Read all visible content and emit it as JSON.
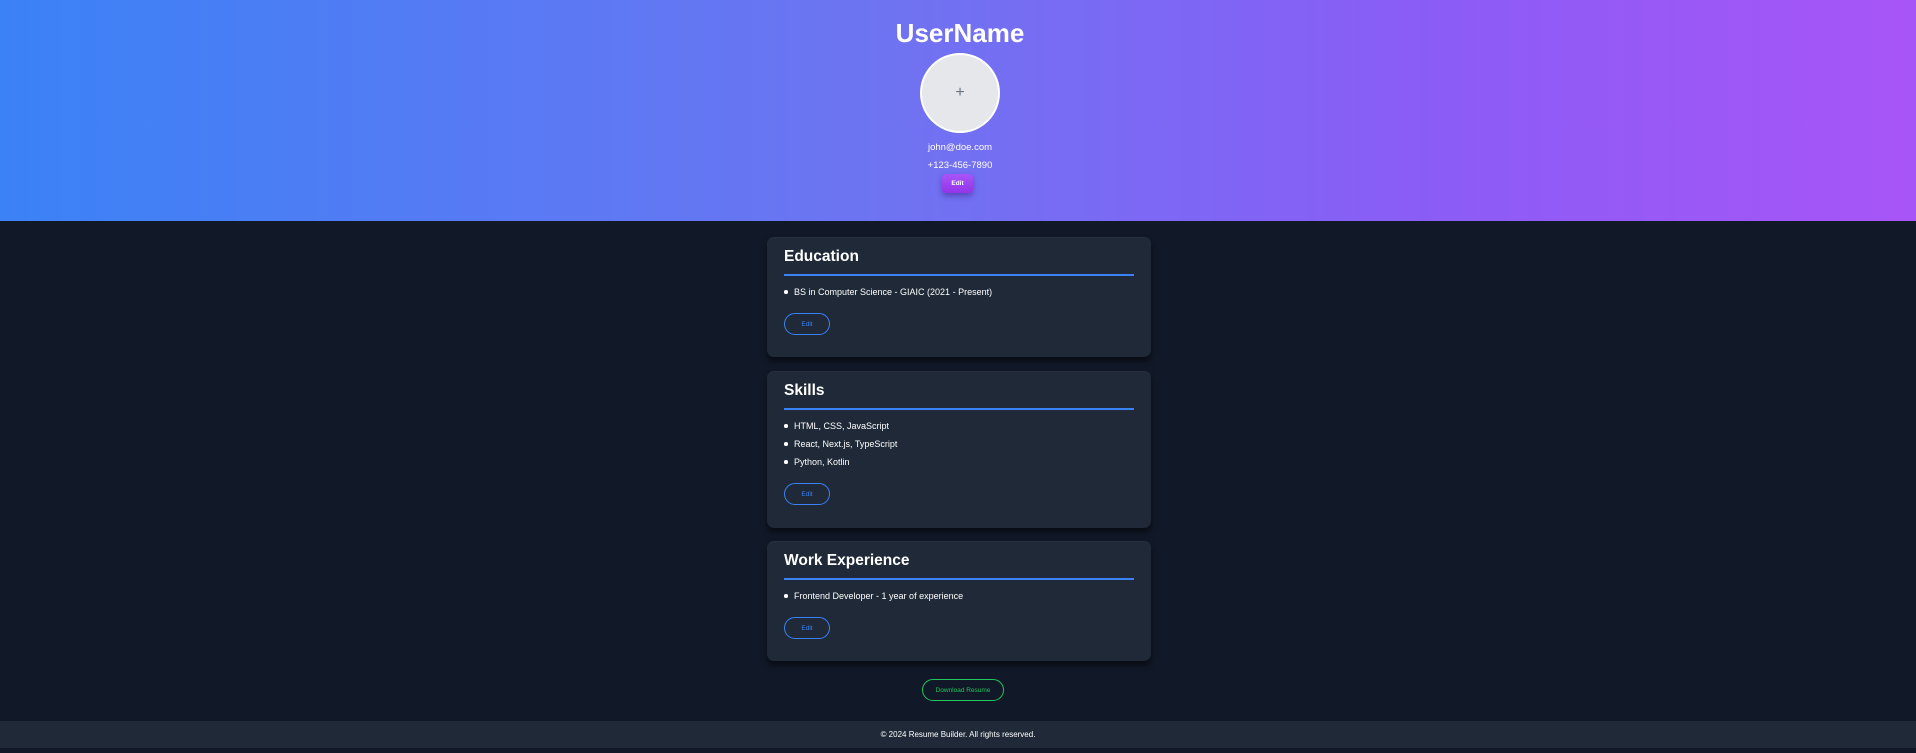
{
  "profile": {
    "name": "UserName",
    "avatar_icon": "+",
    "email": "john@doe.com",
    "phone": "+123-456-7890",
    "edit_label": "Edit"
  },
  "sections": {
    "education": {
      "title": "Education",
      "items": [
        "BS in Computer Science - GIAIC (2021 - Present)"
      ],
      "edit_label": "Edit"
    },
    "skills": {
      "title": "Skills",
      "items": [
        "HTML, CSS, JavaScript",
        "React, Next.js, TypeScript",
        "Python, Kotlin"
      ],
      "edit_label": "Edit"
    },
    "work": {
      "title": "Work Experience",
      "items": [
        "Frontend Developer - 1 year of experience"
      ],
      "edit_label": "Edit"
    }
  },
  "download_label": "Download Resume",
  "footer_text": "© 2024 Resume Builder. All rights reserved.",
  "colors": {
    "accent_blue": "#3b82f6",
    "accent_purple": "#a855f7",
    "accent_green": "#22c55e",
    "background": "#111827",
    "card": "#1f2937"
  }
}
